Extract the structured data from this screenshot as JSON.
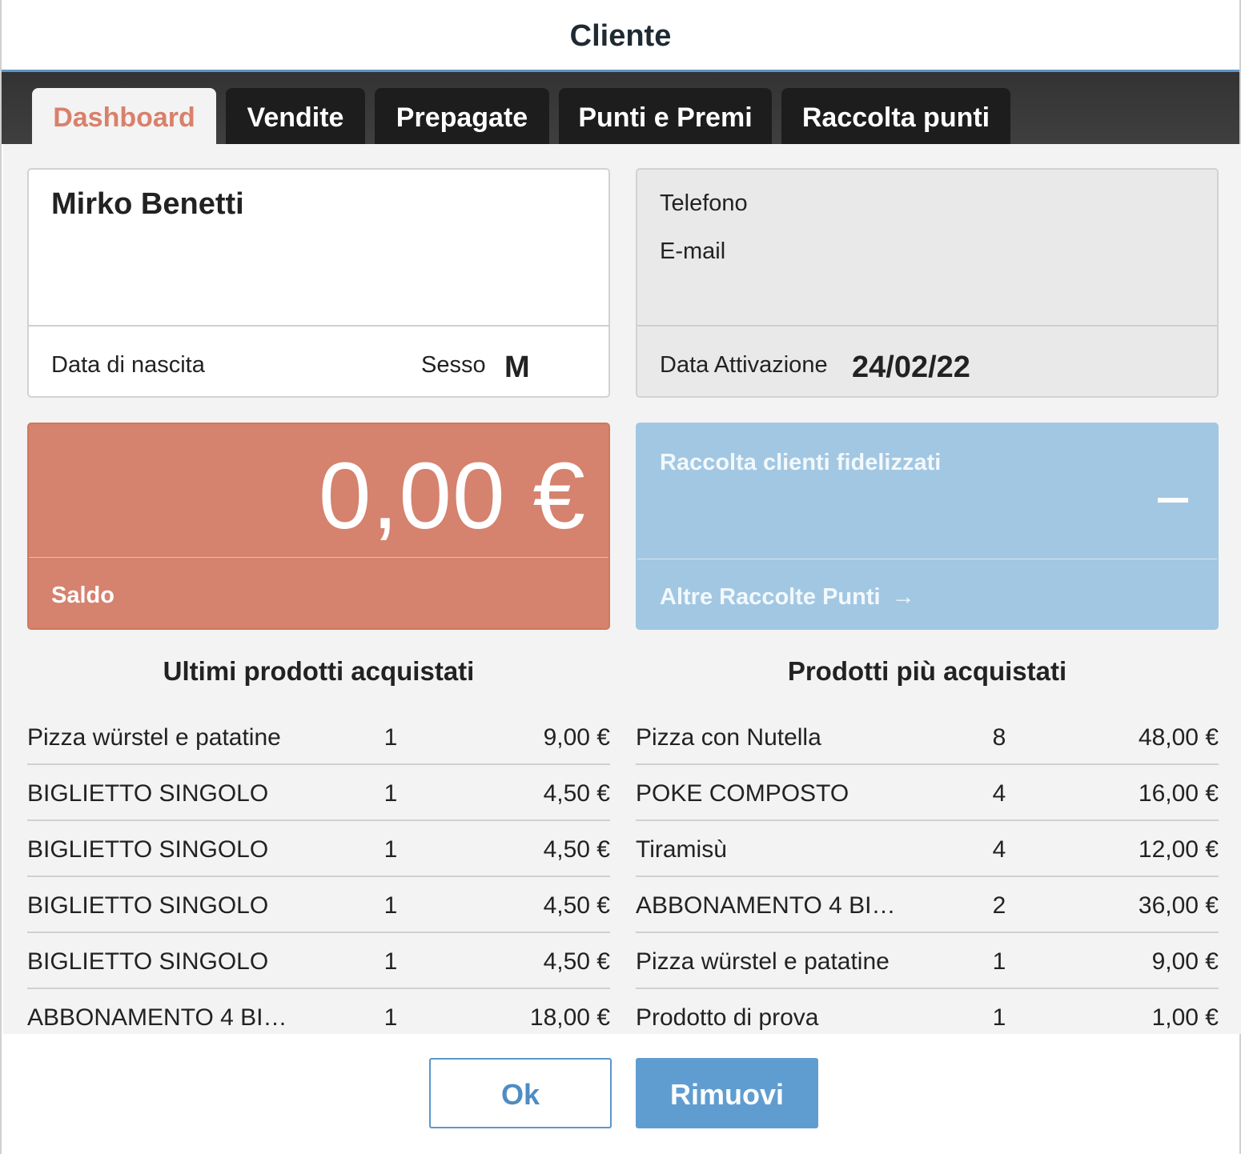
{
  "window": {
    "title": "Cliente"
  },
  "tabs": [
    {
      "label": "Dashboard",
      "active": true
    },
    {
      "label": "Vendite",
      "active": false
    },
    {
      "label": "Prepagate",
      "active": false
    },
    {
      "label": "Punti e Premi",
      "active": false
    },
    {
      "label": "Raccolta punti",
      "active": false
    }
  ],
  "customer": {
    "name": "Mirko Benetti",
    "birth_label": "Data di nascita",
    "gender_label": "Sesso",
    "gender_value": "M",
    "phone_label": "Telefono",
    "email_label": "E-mail",
    "activation_label": "Data Attivazione",
    "activation_value": "24/02/22"
  },
  "balance": {
    "amount": "0,00 €",
    "label": "Saldo",
    "color": "#d5826e"
  },
  "loyalty": {
    "title": "Raccolta clienti fidelizzati",
    "link_label": "Altre Raccolte Punti",
    "arrow": "→",
    "color": "#a2c7e2"
  },
  "recent_products": {
    "title": "Ultimi prodotti acquistati",
    "rows": [
      {
        "name": "Pizza würstel e patatine",
        "qty": "1",
        "price": "9,00 €"
      },
      {
        "name": "BIGLIETTO SINGOLO",
        "qty": "1",
        "price": "4,50 €"
      },
      {
        "name": "BIGLIETTO SINGOLO",
        "qty": "1",
        "price": "4,50 €"
      },
      {
        "name": "BIGLIETTO SINGOLO",
        "qty": "1",
        "price": "4,50 €"
      },
      {
        "name": "BIGLIETTO SINGOLO",
        "qty": "1",
        "price": "4,50 €"
      },
      {
        "name": "ABBONAMENTO 4 BI…",
        "qty": "1",
        "price": "18,00 €"
      }
    ]
  },
  "top_products": {
    "title": "Prodotti più acquistati",
    "rows": [
      {
        "name": "Pizza con Nutella",
        "qty": "8",
        "price": "48,00 €"
      },
      {
        "name": "POKE COMPOSTO",
        "qty": "4",
        "price": "16,00 €"
      },
      {
        "name": "Tiramisù",
        "qty": "4",
        "price": "12,00 €"
      },
      {
        "name": "ABBONAMENTO 4 BI…",
        "qty": "2",
        "price": "36,00 €"
      },
      {
        "name": "Pizza würstel e patatine",
        "qty": "1",
        "price": "9,00 €"
      },
      {
        "name": "Prodotto di prova",
        "qty": "1",
        "price": "1,00 €"
      }
    ]
  },
  "footer": {
    "ok_label": "Ok",
    "remove_label": "Rimuovi"
  }
}
